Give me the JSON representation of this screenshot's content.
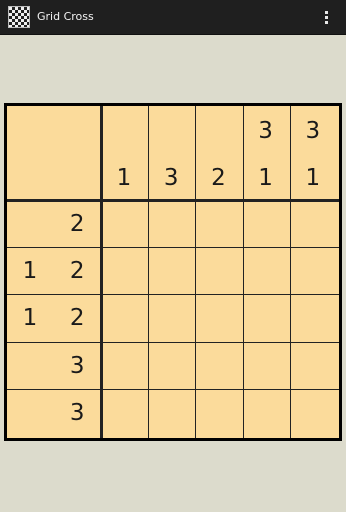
{
  "app": {
    "title": "Grid Cross",
    "icon": "checker-app-icon",
    "menu_icon": "overflow-menu-icon"
  },
  "colors": {
    "actionbar": "#1f1f1f",
    "background": "#dcdbcc",
    "board": "#fbdb9b",
    "lines": "#000000"
  },
  "puzzle": {
    "rows": 5,
    "cols": 5,
    "column_clues": [
      [
        "1"
      ],
      [
        "3"
      ],
      [
        "2"
      ],
      [
        "3",
        "1"
      ],
      [
        "3",
        "1"
      ]
    ],
    "row_clues": [
      [
        "2"
      ],
      [
        "1",
        "2"
      ],
      [
        "1",
        "2"
      ],
      [
        "3"
      ],
      [
        "3"
      ]
    ]
  }
}
